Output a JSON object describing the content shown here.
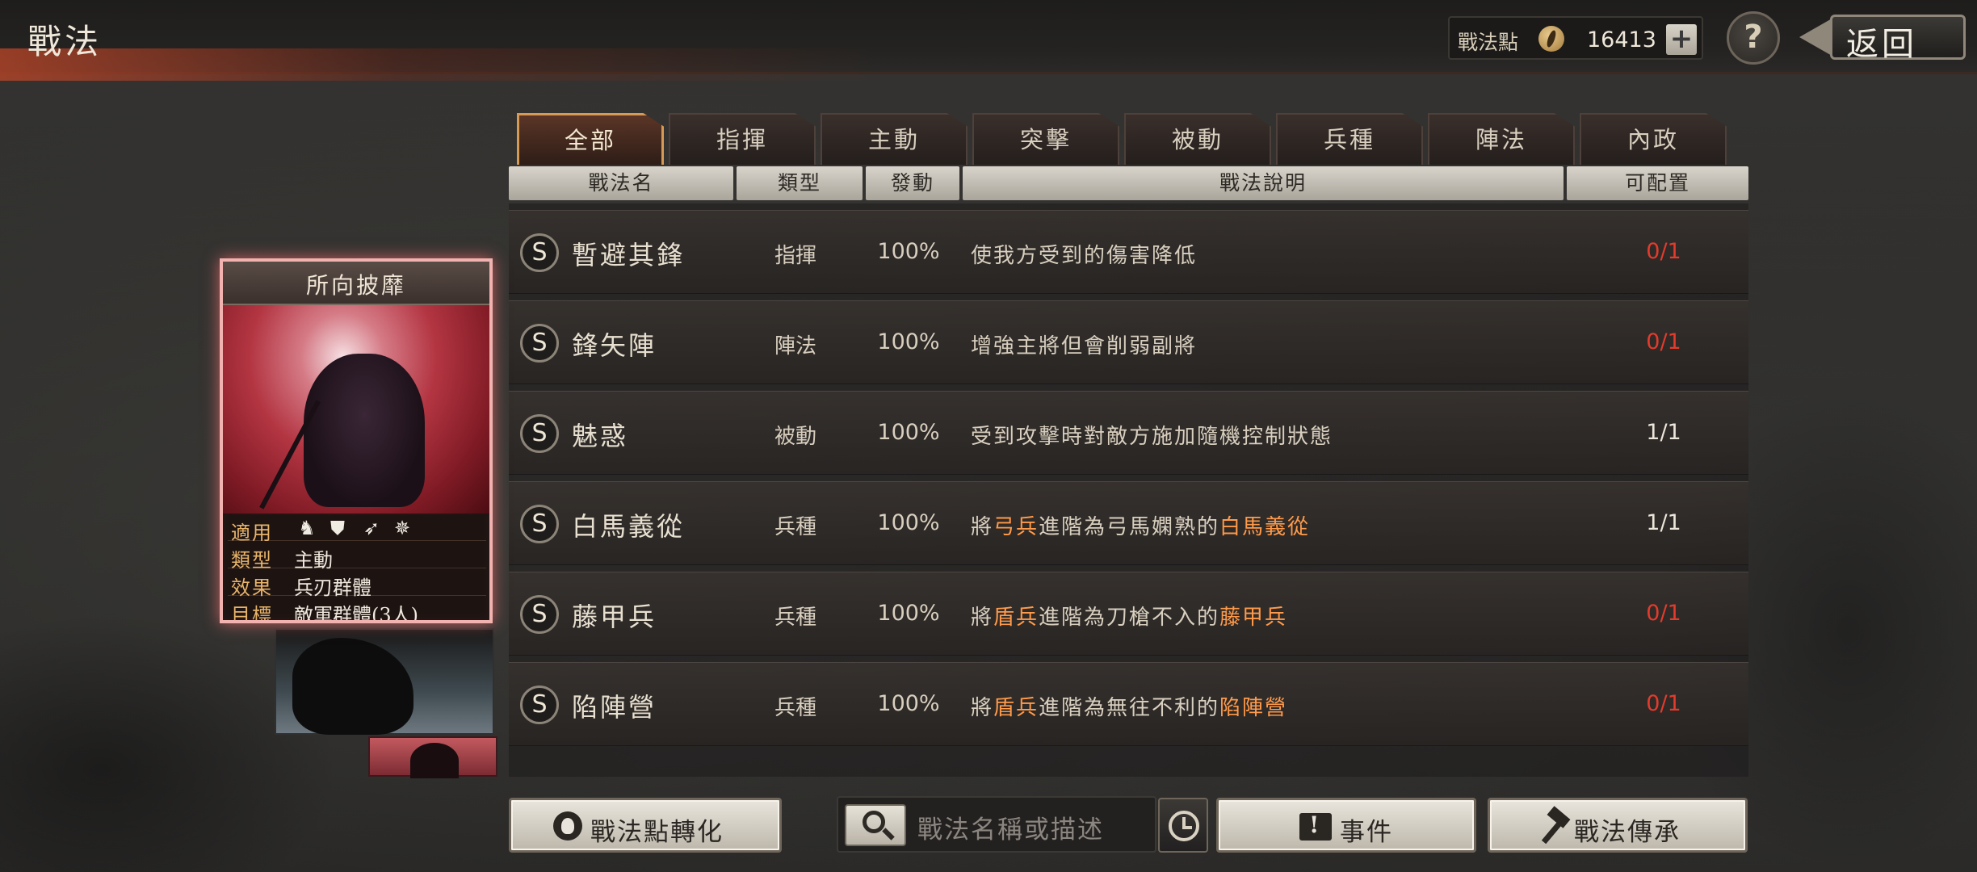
{
  "header": {
    "title": "戰法",
    "points_label": "戰法點",
    "points_value": "16413",
    "plus_label": "+",
    "help_label": "?",
    "back_label": "返回"
  },
  "tabs": [
    {
      "label": "全部",
      "active": true
    },
    {
      "label": "指揮",
      "active": false
    },
    {
      "label": "主動",
      "active": false
    },
    {
      "label": "突擊",
      "active": false
    },
    {
      "label": "被動",
      "active": false
    },
    {
      "label": "兵種",
      "active": false
    },
    {
      "label": "陣法",
      "active": false
    },
    {
      "label": "內政",
      "active": false
    }
  ],
  "columns": {
    "name": "戰法名",
    "type": "類型",
    "rate": "發動",
    "desc": "戰法說明",
    "slots": "可配置"
  },
  "rows": [
    {
      "grade": "S",
      "name": "暫避其鋒",
      "type": "指揮",
      "rate": "100%",
      "desc": [
        {
          "t": "使我方受到的傷害降低"
        }
      ],
      "slots": "0/1",
      "slots_status": "red"
    },
    {
      "grade": "S",
      "name": "鋒矢陣",
      "type": "陣法",
      "rate": "100%",
      "desc": [
        {
          "t": "增強主將但會削弱副將"
        }
      ],
      "slots": "0/1",
      "slots_status": "red"
    },
    {
      "grade": "S",
      "name": "魅惑",
      "type": "被動",
      "rate": "100%",
      "desc": [
        {
          "t": "受到攻擊時對敵方施加隨機控制狀態"
        }
      ],
      "slots": "1/1",
      "slots_status": "white"
    },
    {
      "grade": "S",
      "name": "白馬義從",
      "type": "兵種",
      "rate": "100%",
      "desc": [
        {
          "t": "將"
        },
        {
          "t": "弓兵",
          "hl": true
        },
        {
          "t": "進階為弓馬嫻熟的"
        },
        {
          "t": "白馬義從",
          "hl": true
        }
      ],
      "slots": "1/1",
      "slots_status": "white"
    },
    {
      "grade": "S",
      "name": "藤甲兵",
      "type": "兵種",
      "rate": "100%",
      "desc": [
        {
          "t": "將"
        },
        {
          "t": "盾兵",
          "hl": true
        },
        {
          "t": "進階為刀槍不入的"
        },
        {
          "t": "藤甲兵",
          "hl": true
        }
      ],
      "slots": "0/1",
      "slots_status": "red"
    },
    {
      "grade": "S",
      "name": "陷陣營",
      "type": "兵種",
      "rate": "100%",
      "desc": [
        {
          "t": "將"
        },
        {
          "t": "盾兵",
          "hl": true
        },
        {
          "t": "進階為無往不利的"
        },
        {
          "t": "陷陣營",
          "hl": true
        }
      ],
      "slots": "0/1",
      "slots_status": "red"
    }
  ],
  "card": {
    "title": "所向披靡",
    "info": [
      {
        "key": "適用",
        "value": ""
      },
      {
        "key": "類型",
        "value": "主動"
      },
      {
        "key": "效果",
        "value": "兵刃群體"
      },
      {
        "key": "目標",
        "value": "敵軍群體(3人)"
      }
    ],
    "unit_icons": [
      "cavalry-icon",
      "shield-icon",
      "archer-icon",
      "chariot-icon"
    ]
  },
  "footer": {
    "convert_label": "戰法點轉化",
    "search_placeholder": "戰法名稱或描述",
    "events_label": "事件",
    "inherit_label": "戰法傳承"
  },
  "colors": {
    "accent_orange": "#ff9a4a",
    "slot_red": "#e23b2c",
    "active_tab_border": "#d79a55"
  }
}
